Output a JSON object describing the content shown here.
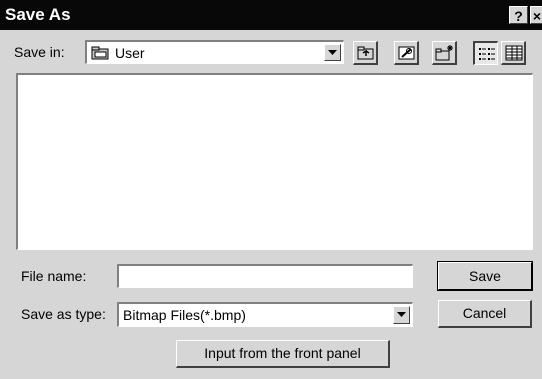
{
  "window": {
    "title": "Save As",
    "help_label": "?",
    "close_label": "×"
  },
  "toolbar": {
    "save_in_label": "Save in:",
    "save_in_value": "User",
    "icons": [
      "folder-icon",
      "up-one-level-icon",
      "desktop-icon",
      "new-folder-icon",
      "list-view-icon",
      "details-view-icon"
    ]
  },
  "file_list": {
    "items": []
  },
  "fields": {
    "file_name_label": "File name:",
    "file_name_value": "",
    "save_as_type_label": "Save as type:",
    "save_as_type_value": "Bitmap Files(*.bmp)"
  },
  "buttons": {
    "save": "Save",
    "cancel": "Cancel",
    "input_front_panel": "Input from the front panel"
  },
  "colors": {
    "titlebar": "#080808",
    "face": "#d6d6d6",
    "shadow": "#808080",
    "dark_shadow": "#404040",
    "highlight": "#ffffff"
  }
}
